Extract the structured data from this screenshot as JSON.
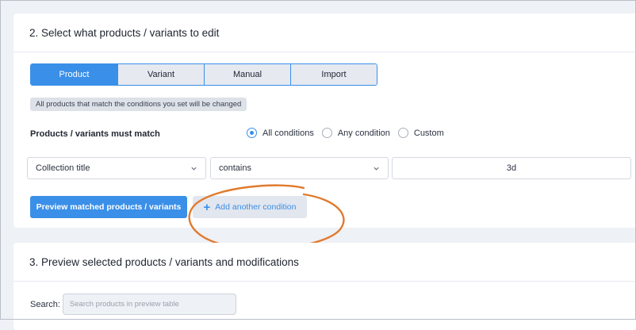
{
  "section_edit": {
    "title": "2. Select what products / variants to edit",
    "tabs": [
      {
        "label": "Product",
        "active": true
      },
      {
        "label": "Variant",
        "active": false
      },
      {
        "label": "Manual",
        "active": false
      },
      {
        "label": "Import",
        "active": false
      }
    ],
    "info_text": "All products that match the conditions you set will be changed",
    "match_label": "Products / variants must match",
    "match_options": [
      {
        "label": "All conditions",
        "checked": true
      },
      {
        "label": "Any condition",
        "checked": false
      },
      {
        "label": "Custom",
        "checked": false
      }
    ],
    "condition": {
      "field": "Collection title",
      "operator": "contains",
      "value": "3d"
    },
    "preview_button": "Preview matched products / variants",
    "add_condition_button": "Add another condition",
    "icons": {
      "add": "plus-icon",
      "dropdown": "chevron-down-icon"
    }
  },
  "section_preview": {
    "title": "3. Preview selected products / variants and modifications",
    "search_label": "Search:",
    "search_placeholder": "Search products in preview table",
    "search_value": ""
  },
  "colors": {
    "accent": "#3a8fe8",
    "annotation": "#e07b2f",
    "background": "#eef1f6"
  }
}
